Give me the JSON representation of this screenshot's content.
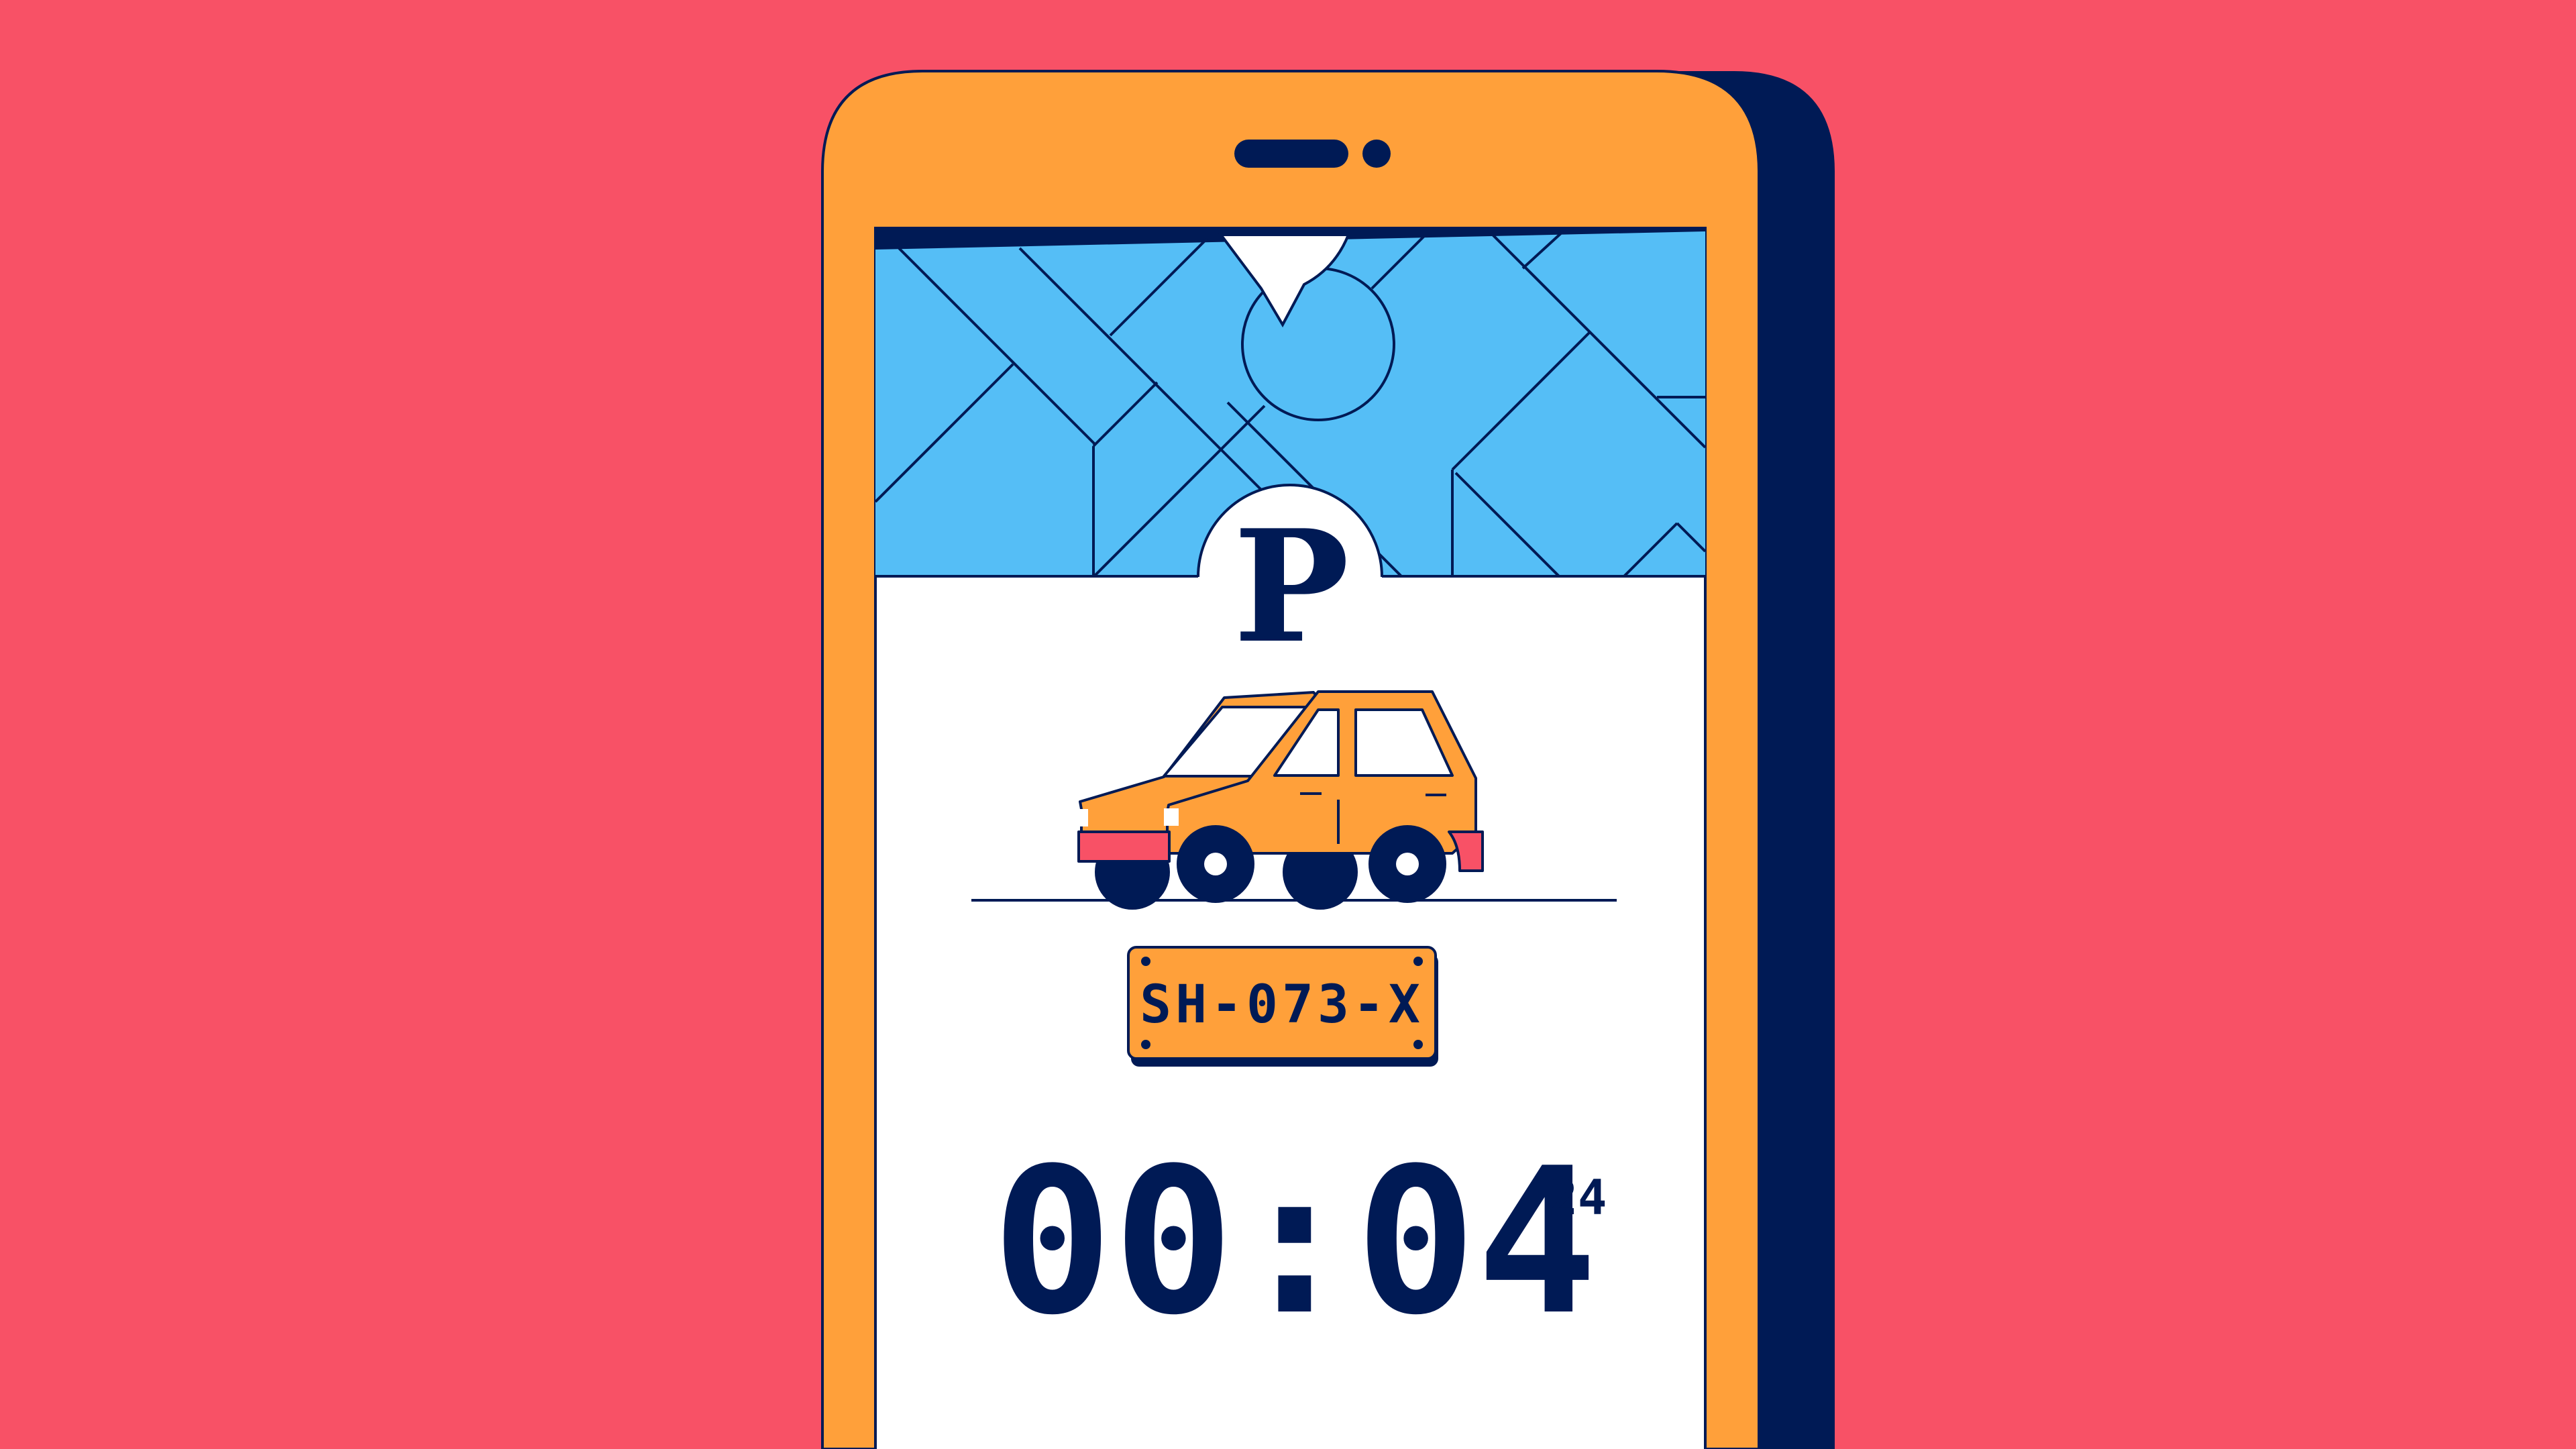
{
  "colors": {
    "background": "#F85166",
    "phone_body": "#FFA03A",
    "phone_shadow": "#001A55",
    "navy": "#001A55",
    "map_water": "#55BEF6",
    "screen": "#FFFFFF",
    "plate": "#FFA03A",
    "bumper": "#F85166"
  },
  "icons": {
    "parking": "parking-icon",
    "car": "car-icon",
    "location_pin": "location-pin-icon",
    "map": "map-icon"
  },
  "parking": {
    "sign_letter": "P"
  },
  "vehicle": {
    "license_plate": "SH-073-X"
  },
  "timer": {
    "main": "00:04",
    "seconds": "24"
  }
}
